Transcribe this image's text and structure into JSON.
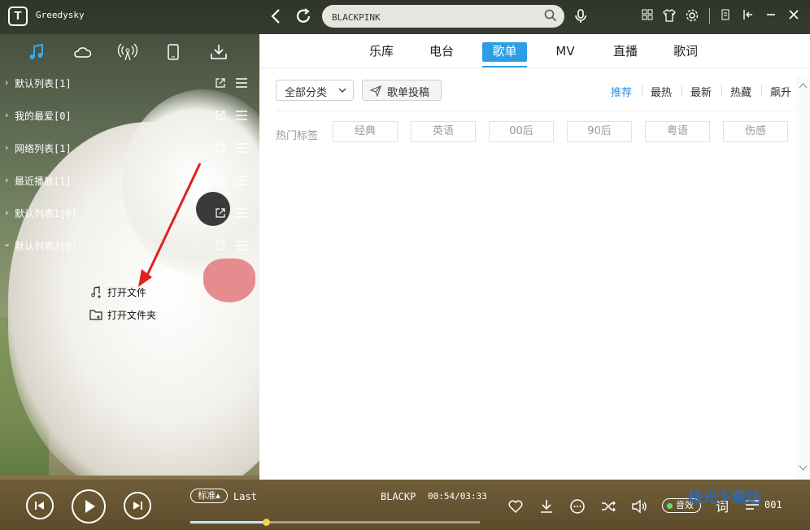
{
  "app": {
    "logo_letter": "T",
    "username": "Greedysky"
  },
  "search": {
    "value": "BLACKPINK",
    "placeholder": ""
  },
  "playlists": [
    {
      "label": "默认列表[1]",
      "expanded": false
    },
    {
      "label": "我的最爱[0]",
      "expanded": false
    },
    {
      "label": "网络列表[1]",
      "expanded": false
    },
    {
      "label": "最近播放[1]",
      "expanded": false
    },
    {
      "label": "默认列表1[0]",
      "expanded": false
    },
    {
      "label": "默认列表2[0]",
      "expanded": true
    }
  ],
  "context": {
    "open_file": "打开文件",
    "open_folder": "打开文件夹"
  },
  "tabs": [
    {
      "label": "乐库",
      "active": false
    },
    {
      "label": "电台",
      "active": false
    },
    {
      "label": "歌单",
      "active": true
    },
    {
      "label": "MV",
      "active": false
    },
    {
      "label": "直播",
      "active": false
    },
    {
      "label": "歌词",
      "active": false
    }
  ],
  "filter": {
    "category": "全部分类",
    "submit": "歌单投稿"
  },
  "sort": [
    {
      "label": "推荐",
      "active": true
    },
    {
      "label": "最热",
      "active": false
    },
    {
      "label": "最新",
      "active": false
    },
    {
      "label": "热藏",
      "active": false
    },
    {
      "label": "飙升",
      "active": false
    }
  ],
  "hot_tags": {
    "label": "热门标签",
    "items": [
      "经典",
      "英语",
      "00后",
      "90后",
      "粤语",
      "伤感"
    ]
  },
  "player": {
    "quality": "标准",
    "prev_track": "Last",
    "current_track": "BLACKP",
    "time": "00:54/03:33",
    "progress": 0.26,
    "effect_label": "音效",
    "lyric_label": "词",
    "count": "001"
  },
  "colors": {
    "accent": "#2d9ee5",
    "tag_text": "#999999",
    "effect_on": "#5fe06a"
  },
  "watermark": "极光下载站"
}
